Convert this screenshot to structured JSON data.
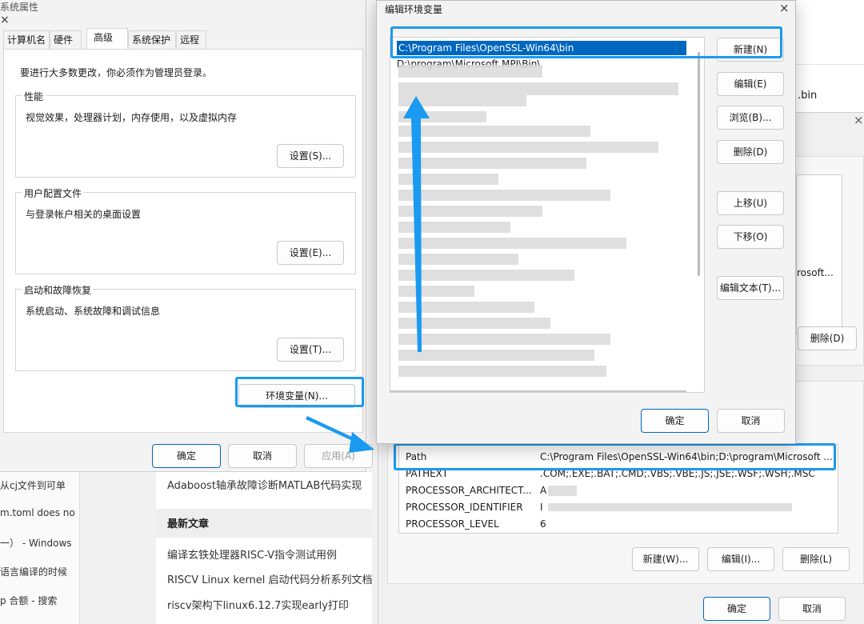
{
  "blog": {
    "left_items": [
      "从cj文件到可单",
      "m.toml does no",
      "一） - Windows",
      "语言编译的时候",
      "p 合额 - 搜索"
    ],
    "related_link": "Adaboost轴承故障诊断MATLAB代码实现",
    "latest_title": "最新文章",
    "latest_links": [
      "编译玄铁处理器RISC-V指令测试用例",
      "RISCV Linux kernel 启动代码分析系列文档",
      "riscv架构下linux6.12.7实现early打印"
    ]
  },
  "sysprops": {
    "title": "系统属性",
    "close_icon": "×",
    "tabs": [
      "计算机名",
      "硬件",
      "高级",
      "系统保护",
      "远程"
    ],
    "admin_note": "要进行大多数更改，你必须作为管理员登录。",
    "groups": [
      {
        "title": "性能",
        "desc": "视觉效果，处理器计划，内存使用，以及虚拟内存",
        "button": "设置(S)..."
      },
      {
        "title": "用户配置文件",
        "desc": "与登录帐户相关的桌面设置",
        "button": "设置(E)..."
      },
      {
        "title": "启动和故障恢复",
        "desc": "系统启动、系统故障和调试信息",
        "button": "设置(T)..."
      }
    ],
    "env_button": "环境变量(N)...",
    "ok": "确定",
    "cancel": "取消",
    "apply": "应用(A)"
  },
  "editdlg": {
    "title": "编辑环境变量",
    "close_icon": "×",
    "entries": [
      "C:\\Program Files\\OpenSSL-Win64\\bin",
      "D:\\program\\Microsoft MPI\\Bin\\"
    ],
    "buttons": {
      "new": "新建(N)",
      "edit": "编辑(E)",
      "browse": "浏览(B)...",
      "delete": "删除(D)",
      "up": "上移(U)",
      "down": "下移(O)",
      "edit_text": "编辑文本(T)..."
    },
    "ok": "确定",
    "cancel": "取消"
  },
  "envwin": {
    "close_icon": "×",
    "partial_bin": ".bin",
    "partial_microsoft": "rosoft...",
    "user_delete": "删除(D)",
    "vars": [
      {
        "name": "Path",
        "value": "C:\\Program Files\\OpenSSL-Win64\\bin;D:\\program\\Microsoft ..."
      },
      {
        "name": "PATHEXT",
        "value": ".COM;.EXE;.BAT;.CMD;.VBS;.VBE;.JS;.JSE;.WSF;.WSH;.MSC"
      },
      {
        "name": "PROCESSOR_ARCHITECT...",
        "value": "A"
      },
      {
        "name": "PROCESSOR_IDENTIFIER",
        "value": "I"
      },
      {
        "name": "PROCESSOR_LEVEL",
        "value": "6"
      }
    ],
    "sys_new": "新建(W)...",
    "sys_edit": "编辑(I)...",
    "sys_delete": "删除(L)",
    "ok": "确定",
    "cancel": "取消"
  },
  "colors": {
    "highlight": "#1a9af0",
    "selection": "#0067c0"
  }
}
